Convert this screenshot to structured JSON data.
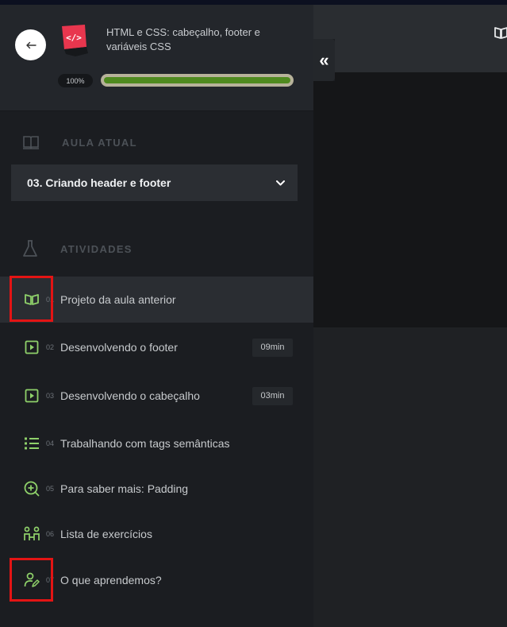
{
  "course": {
    "title": "HTML e CSS: cabeçalho, footer e variáveis CSS",
    "progress_label": "100%",
    "progress": 1.0
  },
  "current_lesson": {
    "section_label": "AULA ATUAL",
    "selected": "03. Criando header e footer"
  },
  "activities": {
    "section_label": "ATIVIDADES",
    "items": [
      {
        "num": "01",
        "title": "Projeto da aula anterior",
        "icon": "book-icon",
        "duration": ""
      },
      {
        "num": "02",
        "title": "Desenvolvendo o footer",
        "icon": "play-icon",
        "duration": "09min"
      },
      {
        "num": "03",
        "title": "Desenvolvendo o cabeçalho",
        "icon": "play-icon",
        "duration": "03min"
      },
      {
        "num": "04",
        "title": "Trabalhando com tags semânticas",
        "icon": "list-icon",
        "duration": ""
      },
      {
        "num": "05",
        "title": "Para saber mais: Padding",
        "icon": "plus-circle-icon",
        "duration": ""
      },
      {
        "num": "06",
        "title": "Lista de exercícios",
        "icon": "exercise-icon",
        "duration": ""
      },
      {
        "num": "07",
        "title": "O que aprendemos?",
        "icon": "user-edit-icon",
        "duration": ""
      }
    ]
  },
  "colors": {
    "accent_green": "#8fd16a",
    "progress_fill": "#4f8a1f",
    "highlight_red": "#e31414",
    "course_icon": "#e8364e"
  }
}
